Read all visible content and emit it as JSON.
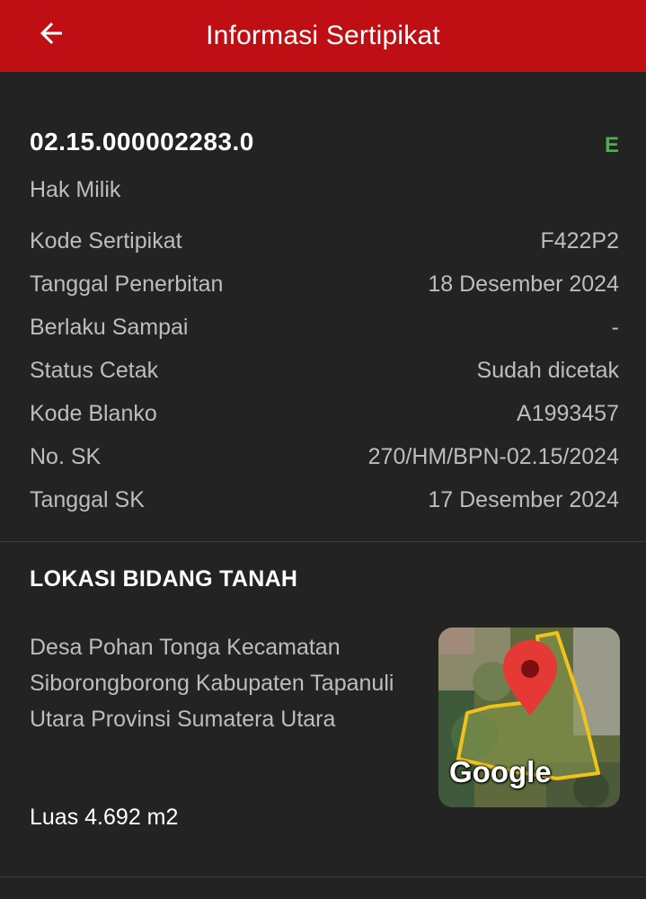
{
  "header": {
    "title": "Informasi Sertipikat",
    "back_icon": "arrow-left-icon"
  },
  "certificate": {
    "number": "02.15.000002283.0",
    "badge": "E",
    "badge_color": "#4caf50",
    "type": "Hak Milik",
    "details": [
      {
        "label": "Kode Sertipikat",
        "value": "F422P2"
      },
      {
        "label": "Tanggal Penerbitan",
        "value": "18 Desember 2024"
      },
      {
        "label": "Berlaku Sampai",
        "value": "-"
      },
      {
        "label": "Status Cetak",
        "value": "Sudah dicetak"
      },
      {
        "label": "Kode Blanko",
        "value": "A1993457"
      },
      {
        "label": "No. SK",
        "value": "270/HM/BPN-02.15/2024"
      },
      {
        "label": "Tanggal SK",
        "value": "17 Desember 2024"
      }
    ]
  },
  "location": {
    "title": "LOKASI BIDANG TANAH",
    "address": "Desa Pohan Tonga Kecamatan Siborongborong Kabupaten Tapanuli Utara Provinsi Sumatera Utara",
    "area": "Luas 4.692 m2",
    "map_logo": "Google",
    "map_icon": "map-pin-icon"
  },
  "colors": {
    "appbar": "#c00f14",
    "background": "#232323"
  }
}
